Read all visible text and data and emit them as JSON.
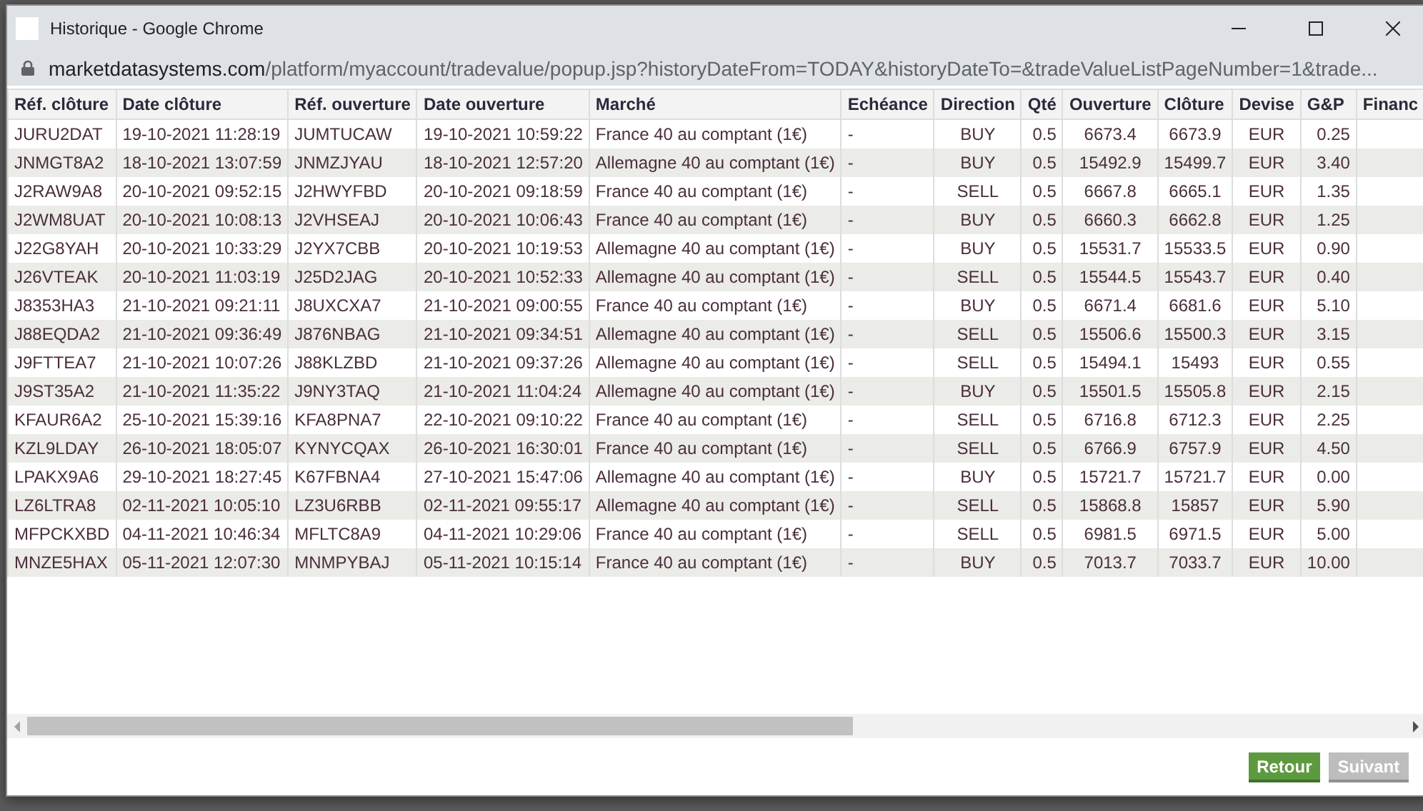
{
  "window": {
    "title": "Historique - Google Chrome",
    "url_host": "marketdatasystems.com",
    "url_path": "/platform/myaccount/tradevalue/popup.jsp?historyDateFrom=TODAY&historyDateTo=&tradeValueListPageNumber=1&trade..."
  },
  "table": {
    "columns": [
      "Réf. clôture",
      "Date clôture",
      "Réf. ouverture",
      "Date ouverture",
      "Marché",
      "Echéance",
      "Direction",
      "Qté",
      "Ouverture",
      "Clôture",
      "Devise",
      "G&P",
      "Financ"
    ],
    "rows": [
      [
        "JURU2DAT",
        "19-10-2021 11:28:19",
        "JUMTUCAW",
        "19-10-2021 10:59:22",
        "France 40 au comptant (1€)",
        "-",
        "BUY",
        "0.5",
        "6673.4",
        "6673.9",
        "EUR",
        "0.25"
      ],
      [
        "JNMGT8A2",
        "18-10-2021 13:07:59",
        "JNMZJYAU",
        "18-10-2021 12:57:20",
        "Allemagne 40 au comptant (1€)",
        "-",
        "BUY",
        "0.5",
        "15492.9",
        "15499.7",
        "EUR",
        "3.40"
      ],
      [
        "J2RAW9A8",
        "20-10-2021 09:52:15",
        "J2HWYFBD",
        "20-10-2021 09:18:59",
        "France 40 au comptant (1€)",
        "-",
        "SELL",
        "0.5",
        "6667.8",
        "6665.1",
        "EUR",
        "1.35"
      ],
      [
        "J2WM8UAT",
        "20-10-2021 10:08:13",
        "J2VHSEAJ",
        "20-10-2021 10:06:43",
        "France 40 au comptant (1€)",
        "-",
        "BUY",
        "0.5",
        "6660.3",
        "6662.8",
        "EUR",
        "1.25"
      ],
      [
        "J22G8YAH",
        "20-10-2021 10:33:29",
        "J2YX7CBB",
        "20-10-2021 10:19:53",
        "Allemagne 40 au comptant (1€)",
        "-",
        "BUY",
        "0.5",
        "15531.7",
        "15533.5",
        "EUR",
        "0.90"
      ],
      [
        "J26VTEAK",
        "20-10-2021 11:03:19",
        "J25D2JAG",
        "20-10-2021 10:52:33",
        "Allemagne 40 au comptant (1€)",
        "-",
        "SELL",
        "0.5",
        "15544.5",
        "15543.7",
        "EUR",
        "0.40"
      ],
      [
        "J8353HA3",
        "21-10-2021 09:21:11",
        "J8UXCXA7",
        "21-10-2021 09:00:55",
        "France 40 au comptant (1€)",
        "-",
        "BUY",
        "0.5",
        "6671.4",
        "6681.6",
        "EUR",
        "5.10"
      ],
      [
        "J88EQDA2",
        "21-10-2021 09:36:49",
        "J876NBAG",
        "21-10-2021 09:34:51",
        "Allemagne 40 au comptant (1€)",
        "-",
        "SELL",
        "0.5",
        "15506.6",
        "15500.3",
        "EUR",
        "3.15"
      ],
      [
        "J9FTTEA7",
        "21-10-2021 10:07:26",
        "J88KLZBD",
        "21-10-2021 09:37:26",
        "Allemagne 40 au comptant (1€)",
        "-",
        "SELL",
        "0.5",
        "15494.1",
        "15493",
        "EUR",
        "0.55"
      ],
      [
        "J9ST35A2",
        "21-10-2021 11:35:22",
        "J9NY3TAQ",
        "21-10-2021 11:04:24",
        "Allemagne 40 au comptant (1€)",
        "-",
        "BUY",
        "0.5",
        "15501.5",
        "15505.8",
        "EUR",
        "2.15"
      ],
      [
        "KFAUR6A2",
        "25-10-2021 15:39:16",
        "KFA8PNA7",
        "22-10-2021 09:10:22",
        "France 40 au comptant (1€)",
        "-",
        "SELL",
        "0.5",
        "6716.8",
        "6712.3",
        "EUR",
        "2.25"
      ],
      [
        "KZL9LDAY",
        "26-10-2021 18:05:07",
        "KYNYCQAX",
        "26-10-2021 16:30:01",
        "France 40 au comptant (1€)",
        "-",
        "SELL",
        "0.5",
        "6766.9",
        "6757.9",
        "EUR",
        "4.50"
      ],
      [
        "LPAKX9A6",
        "29-10-2021 18:27:45",
        "K67FBNA4",
        "27-10-2021 15:47:06",
        "Allemagne 40 au comptant (1€)",
        "-",
        "BUY",
        "0.5",
        "15721.7",
        "15721.7",
        "EUR",
        "0.00"
      ],
      [
        "LZ6LTRA8",
        "02-11-2021 10:05:10",
        "LZ3U6RBB",
        "02-11-2021 09:55:17",
        "Allemagne 40 au comptant (1€)",
        "-",
        "SELL",
        "0.5",
        "15868.8",
        "15857",
        "EUR",
        "5.90"
      ],
      [
        "MFPCKXBD",
        "04-11-2021 10:46:34",
        "MFLTC8A9",
        "04-11-2021 10:29:06",
        "France 40 au comptant (1€)",
        "-",
        "SELL",
        "0.5",
        "6981.5",
        "6971.5",
        "EUR",
        "5.00"
      ],
      [
        "MNZE5HAX",
        "05-11-2021 12:07:30",
        "MNMPYBAJ",
        "05-11-2021 10:15:14",
        "France 40 au comptant (1€)",
        "-",
        "BUY",
        "0.5",
        "7013.7",
        "7033.7",
        "EUR",
        "10.00"
      ]
    ]
  },
  "buttons": [
    {
      "label": "Retour",
      "disabled": false
    },
    {
      "label": "Suivant",
      "disabled": true
    }
  ]
}
